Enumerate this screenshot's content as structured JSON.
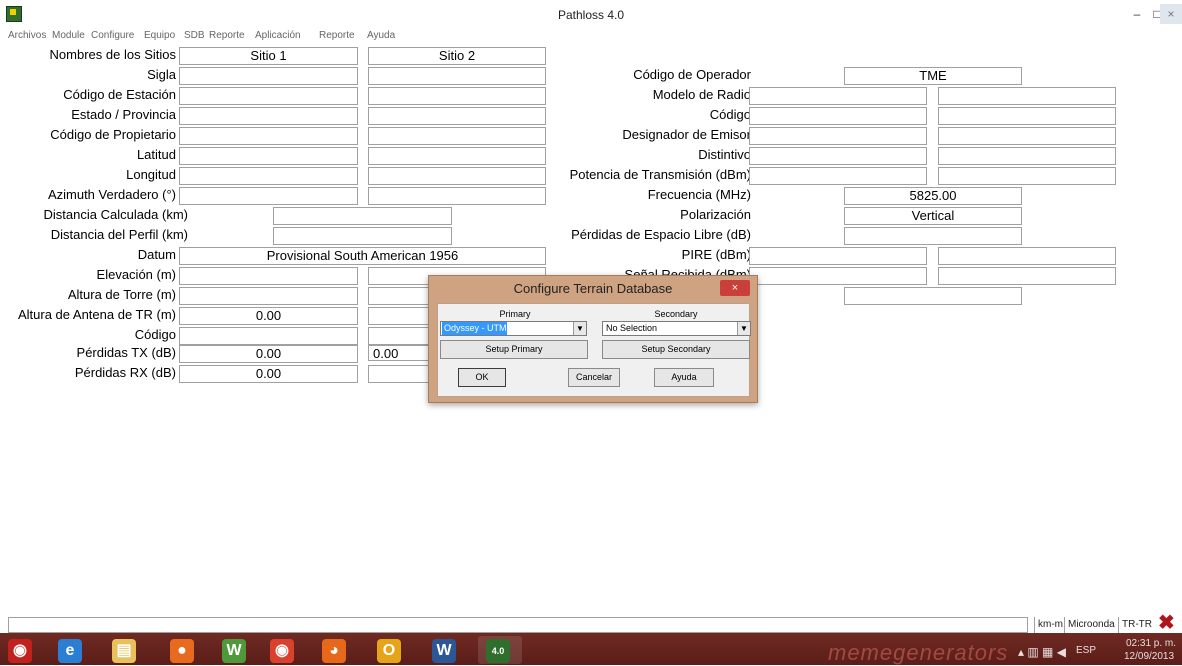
{
  "window": {
    "title": "Pathloss 4.0",
    "min": "–",
    "max": "□",
    "close": "×"
  },
  "menu": [
    "Archivos",
    "Module",
    "Configure",
    "Equipo",
    "SDB",
    "Reporte",
    "Aplicación",
    "Reporte",
    "Ayuda"
  ],
  "left_form": {
    "header_label": "Nombres de los Sitios",
    "site1": "Sitio 1",
    "site2": "Sitio 2",
    "labels": {
      "sigla": "Sigla",
      "codigo_estacion": "Código de Estación",
      "estado": "Estado / Provincia",
      "codigo_propietario": "Código de Propietario",
      "latitud": "Latitud",
      "longitud": "Longitud",
      "azimuth": "Azimuth Verdadero (°)",
      "distancia_calc": "Distancia Calculada (km)",
      "distancia_perfil": "Distancia del Perfil (km)",
      "datum": "Datum",
      "elevacion": "Elevación (m)",
      "altura_torre": "Altura de Torre (m)",
      "altura_antena": "Altura de Antena de TR (m)",
      "codigo": "Código",
      "perdidas_tx": "Pérdidas TX (dB)",
      "perdidas_rx": "Pérdidas RX (dB)"
    },
    "values": {
      "datum": "Provisional South American 1956",
      "altura_antena_1": "0.00",
      "perdidas_tx_1": "0.00",
      "perdidas_tx_2": "0.00",
      "perdidas_rx_1": "0.00"
    }
  },
  "right_form": {
    "labels": {
      "codigo_operador": "Código de Operador",
      "modelo_radio": "Modelo de Radio",
      "codigo": "Código",
      "designador": "Designador de Emisor",
      "distintivo": "Distintivo",
      "potencia": "Potencia de Transmisión (dBm)",
      "frecuencia": "Frecuencia (MHz)",
      "polarizacion": "Polarización",
      "perdidas_espacio": "Pérdidas de Espacio Libre (dB)",
      "pire": "PIRE (dBm)",
      "senal": "Señal Recibida (dBm)"
    },
    "values": {
      "codigo_operador": "TME",
      "frecuencia": "5825.00",
      "polarizacion": "Vertical"
    }
  },
  "dialog": {
    "title": "Configure Terrain Database",
    "close": "×",
    "primary_label": "Primary",
    "secondary_label": "Secondary",
    "primary_value": "Odyssey - UTM",
    "secondary_value": "No Selection",
    "setup_primary": "Setup Primary",
    "setup_secondary": "Setup Secondary",
    "ok": "OK",
    "cancel": "Cancelar",
    "help": "Ayuda",
    "arrow": "▼"
  },
  "statusbar": {
    "units": "km-m",
    "mode": "Microonda",
    "link": "TR-TR",
    "close_icon": "✖"
  },
  "taskbar": {
    "apps": [
      {
        "icon": "start-orb-icon",
        "glyph": "◉",
        "color": "#c2221e"
      },
      {
        "icon": "internet-explorer-icon",
        "glyph": "e",
        "color": "#2a7fd4"
      },
      {
        "icon": "file-explorer-icon",
        "glyph": "▤",
        "color": "#e9c15a"
      },
      {
        "icon": "media-player-icon",
        "glyph": "●",
        "color": "#e76a1e"
      },
      {
        "icon": "wamp-icon",
        "glyph": "W",
        "color": "#4e9a3a"
      },
      {
        "icon": "chrome-icon",
        "glyph": "◉",
        "color": "#d9412e"
      },
      {
        "icon": "firefox-icon",
        "glyph": "◕",
        "color": "#e6681a"
      },
      {
        "icon": "outlook-icon",
        "glyph": "O",
        "color": "#e6a519"
      },
      {
        "icon": "word-icon",
        "glyph": "W",
        "color": "#2b5797"
      },
      {
        "icon": "pathloss-icon",
        "glyph": "4.0",
        "color": "#2f6e2c"
      }
    ],
    "language": "ESP",
    "time": "02:31 p. m.",
    "date": "12/09/2013",
    "watermark": "memegenerators"
  }
}
